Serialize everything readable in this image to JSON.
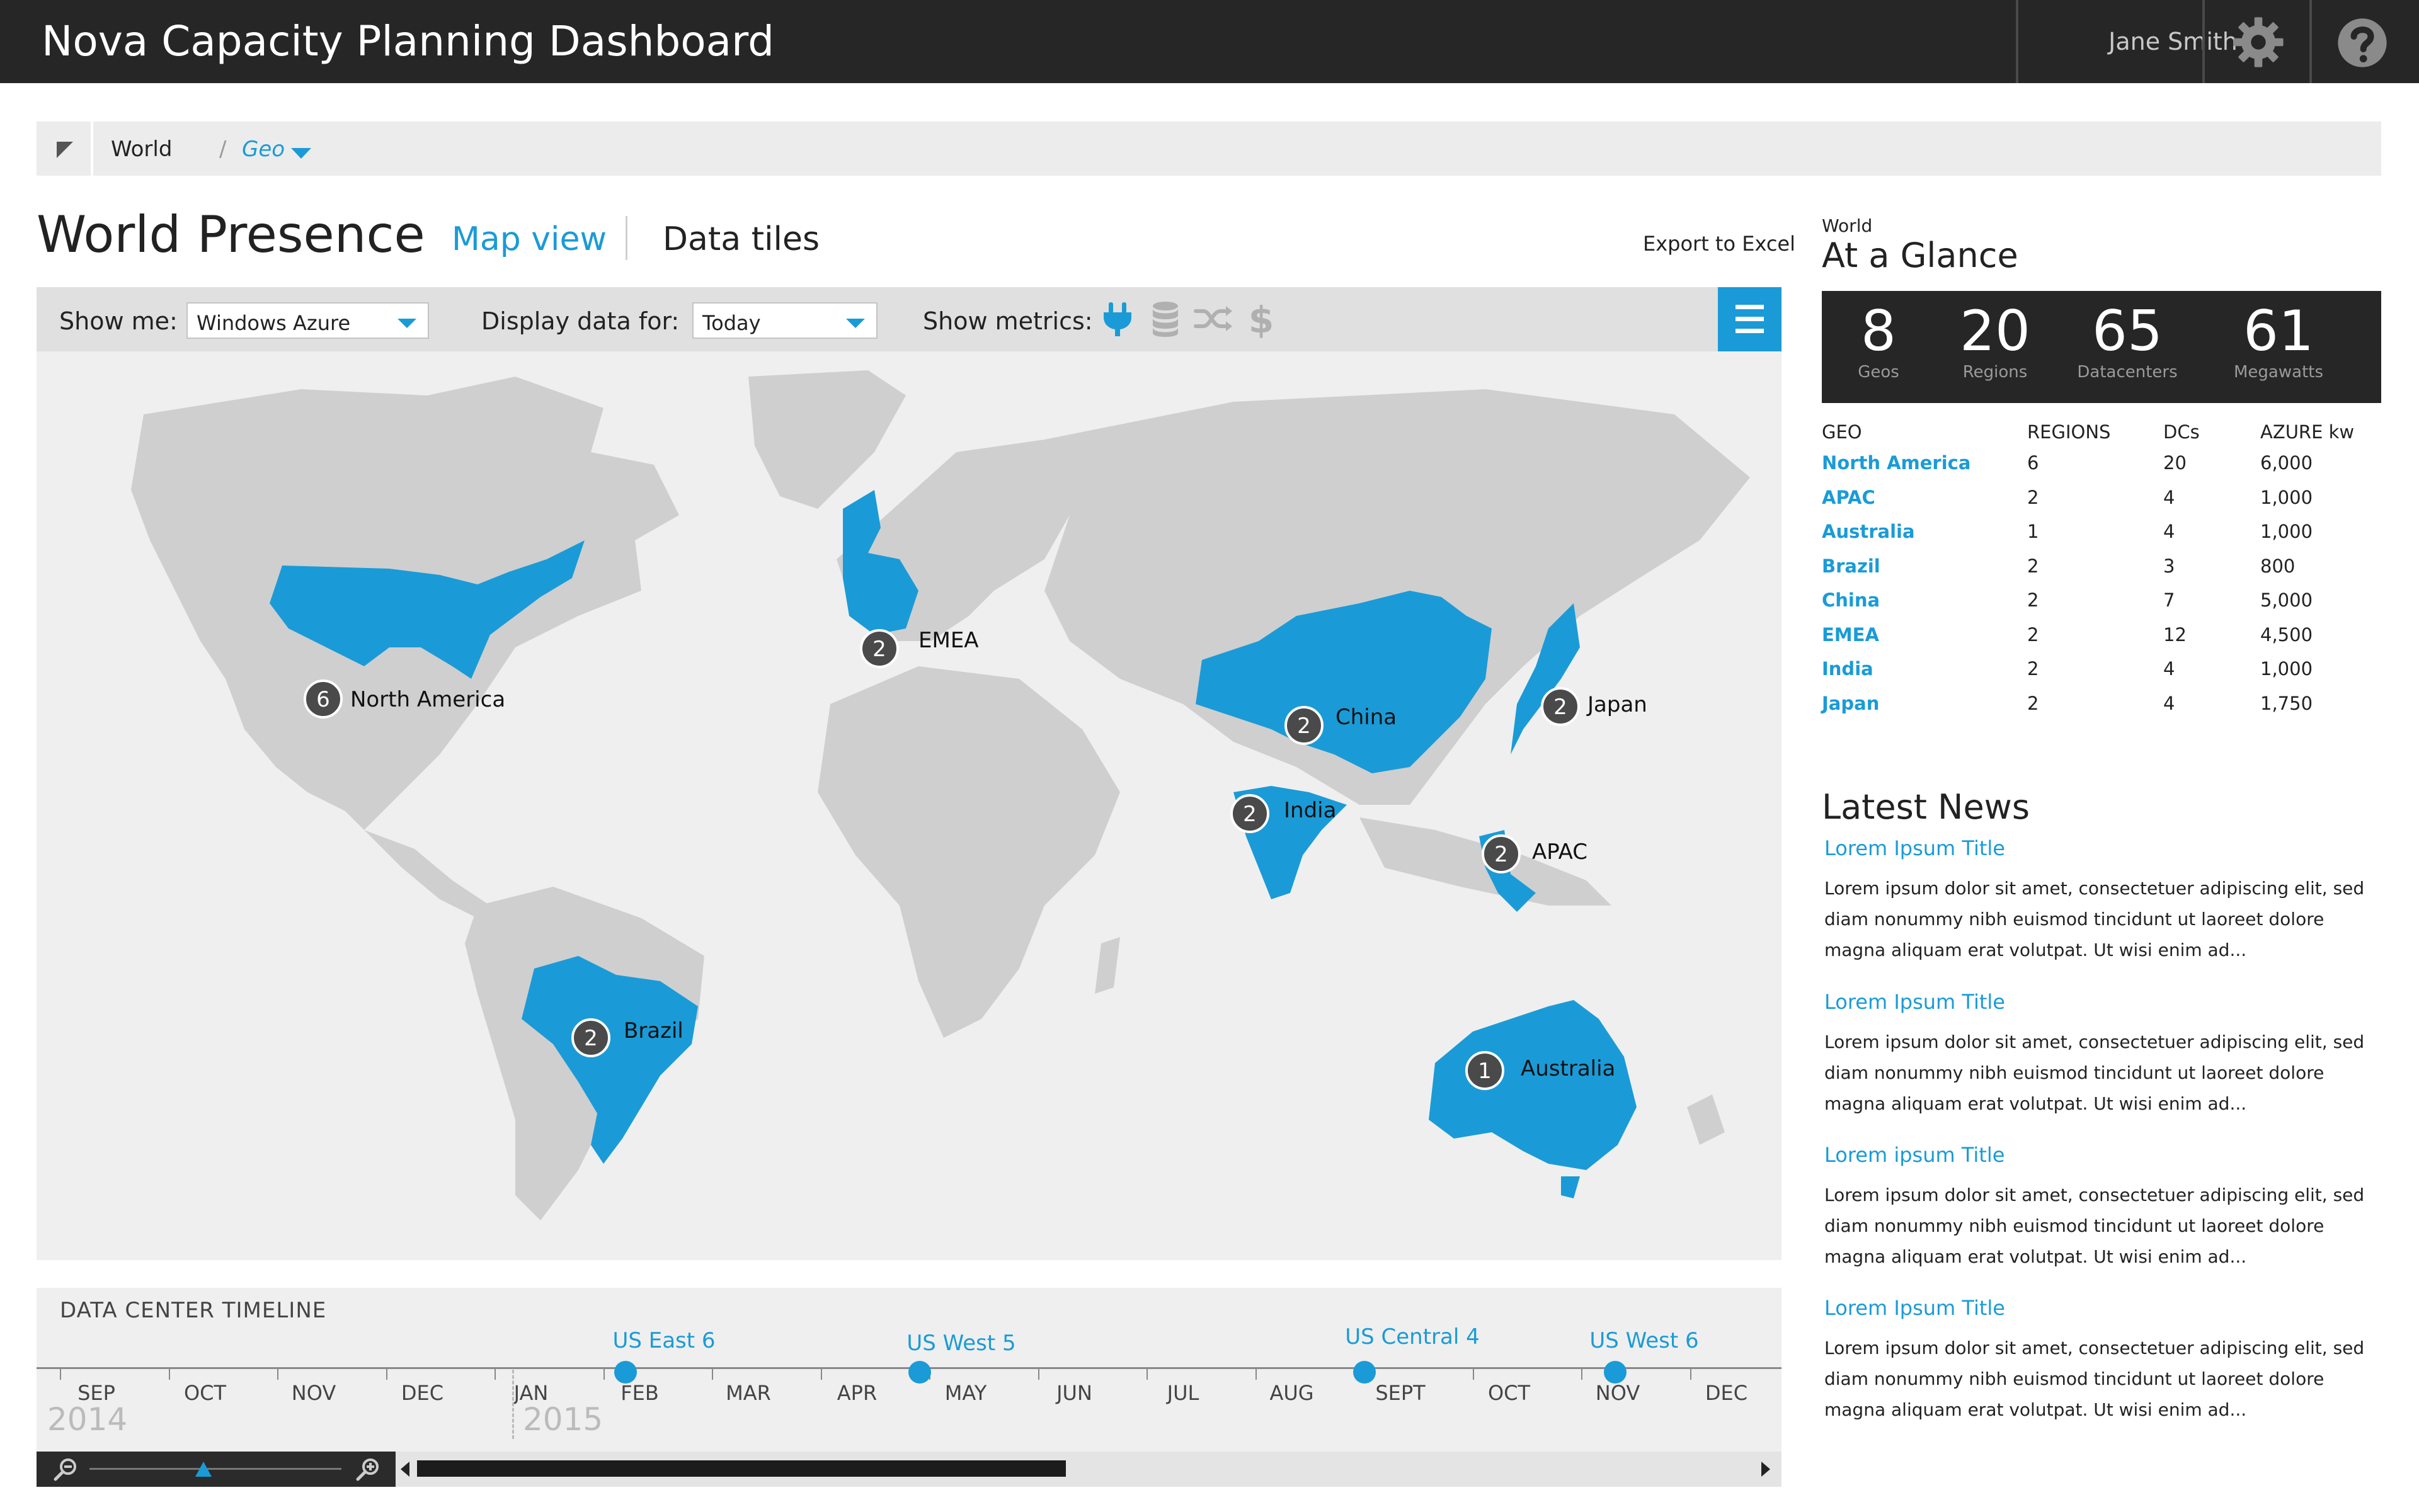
{
  "app": {
    "title": "Nova Capacity Planning Dashboard",
    "user": "Jane Smith"
  },
  "icons": {
    "settings": "gear-icon",
    "help": "help-icon",
    "collapse": "corner-arrow-icon"
  },
  "breadcrumb": {
    "root": "World",
    "separator": "/",
    "current": "Geo"
  },
  "page": {
    "title": "World Presence",
    "tabs": [
      {
        "label": "Map view",
        "active": true
      },
      {
        "label": "Data tiles",
        "active": false
      }
    ],
    "export_label": "Export to Excel"
  },
  "toolbar": {
    "show_me_label": "Show me:",
    "show_me_value": "Windows Azure",
    "display_for_label": "Display data for:",
    "display_for_value": "Today",
    "metrics_label": "Show metrics:",
    "metrics": [
      {
        "icon": "power-plug-icon",
        "active": true
      },
      {
        "icon": "database-icon",
        "active": false
      },
      {
        "icon": "shuffle-icon",
        "active": false
      },
      {
        "icon": "dollar-icon",
        "active": false
      }
    ]
  },
  "map": {
    "land_color": "#cfcfcf",
    "highlight_color": "#1a9bd7",
    "pins": [
      {
        "id": "north-america",
        "label": "North America",
        "count": "6"
      },
      {
        "id": "emea",
        "label": "EMEA",
        "count": "2"
      },
      {
        "id": "china",
        "label": "China",
        "count": "2"
      },
      {
        "id": "japan",
        "label": "Japan",
        "count": "2"
      },
      {
        "id": "india",
        "label": "India",
        "count": "2"
      },
      {
        "id": "apac",
        "label": "APAC",
        "count": "2"
      },
      {
        "id": "brazil",
        "label": "Brazil",
        "count": "2"
      },
      {
        "id": "australia",
        "label": "Australia",
        "count": "1"
      }
    ]
  },
  "timeline": {
    "title": "DATA CENTER TIMELINE",
    "months": [
      "SEP",
      "OCT",
      "NOV",
      "DEC",
      "JAN",
      "FEB",
      "MAR",
      "APR",
      "MAY",
      "JUN",
      "JUL",
      "AUG",
      "SEPT",
      "OCT",
      "NOV",
      "DEC"
    ],
    "years": [
      "2014",
      "2015"
    ],
    "events": [
      {
        "label": "US East 6",
        "month": "FEB 2015"
      },
      {
        "label": "US West 5",
        "month": "APR 2015"
      },
      {
        "label": "US Central 4",
        "month": "AUG 2015"
      },
      {
        "label": "US West 6",
        "month": "NOV 2015"
      }
    ]
  },
  "glance": {
    "kicker": "World",
    "title": "At a Glance",
    "kpis": [
      {
        "value": "8",
        "label": "Geos"
      },
      {
        "value": "20",
        "label": "Regions"
      },
      {
        "value": "65",
        "label": "Datacenters"
      },
      {
        "value": "61",
        "label": "Megawatts"
      }
    ],
    "columns": [
      "GEO",
      "REGIONS",
      "DCs",
      "AZURE kw"
    ],
    "rows": [
      [
        "North America",
        "6",
        "20",
        "6,000"
      ],
      [
        "APAC",
        "2",
        "4",
        "1,000"
      ],
      [
        "Australia",
        "1",
        "4",
        "1,000"
      ],
      [
        "Brazil",
        "2",
        "3",
        "800"
      ],
      [
        "China",
        "2",
        "7",
        "5,000"
      ],
      [
        "EMEA",
        "2",
        "12",
        "4,500"
      ],
      [
        "India",
        "2",
        "4",
        "1,000"
      ],
      [
        "Japan",
        "2",
        "4",
        "1,750"
      ]
    ]
  },
  "news": {
    "title": "Latest News",
    "items": [
      {
        "title": "Lorem Ipsum Title",
        "body": "Lorem ipsum dolor sit amet, consectetuer adipiscing elit, sed diam nonummy nibh euismod tincidunt ut laoreet dolore magna aliquam erat volutpat. Ut wisi enim ad..."
      },
      {
        "title": "Lorem Ipsum Title",
        "body": "Lorem ipsum dolor sit amet, consectetuer adipiscing elit, sed diam nonummy nibh euismod tincidunt ut laoreet dolore magna aliquam erat volutpat. Ut wisi enim ad..."
      },
      {
        "title": "Lorem ipsum Title",
        "body": "Lorem ipsum dolor sit amet, consectetuer adipiscing elit, sed diam nonummy nibh euismod tincidunt ut laoreet dolore magna aliquam erat volutpat. Ut wisi enim ad..."
      },
      {
        "title": "Lorem Ipsum Title",
        "body": "Lorem ipsum dolor sit amet, consectetuer adipiscing elit, sed diam nonummy nibh euismod tincidunt ut laoreet dolore magna aliquam erat volutpat. Ut wisi enim ad..."
      }
    ]
  }
}
